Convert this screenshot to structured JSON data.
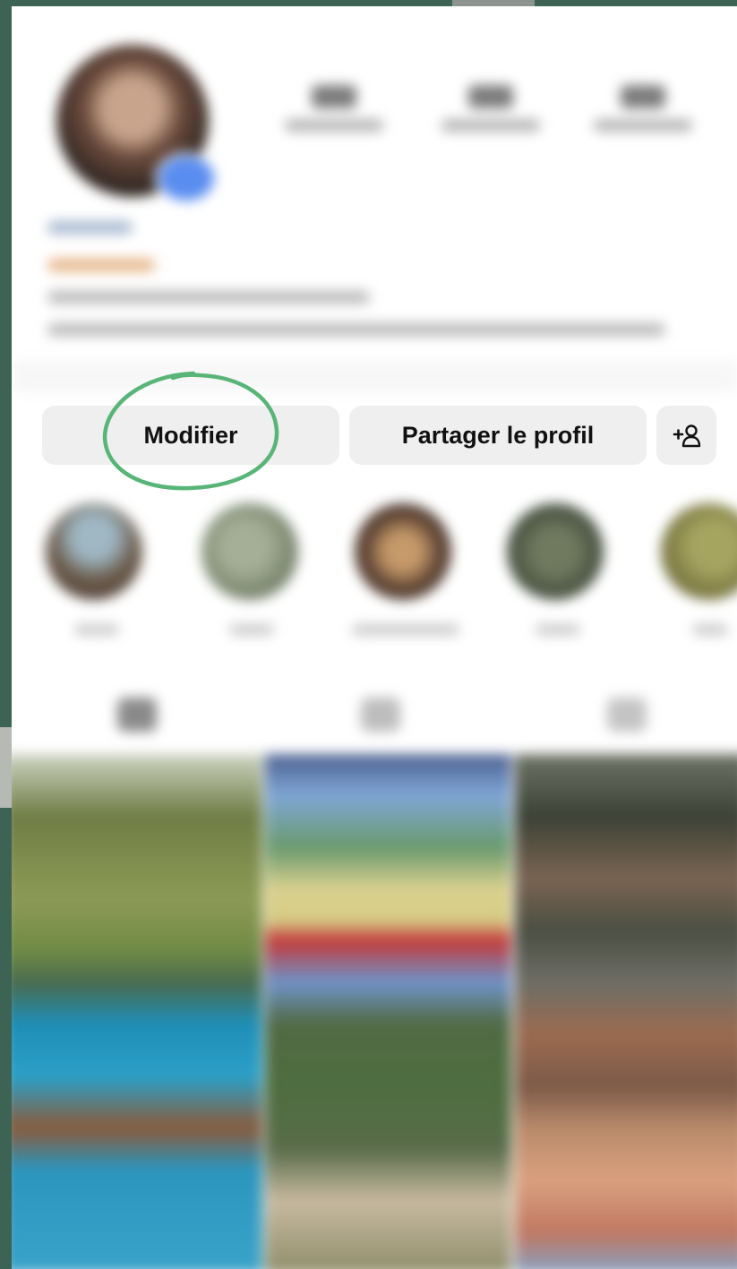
{
  "actions": {
    "edit_label": "Modifier",
    "share_label": "Partager le profil",
    "add_person_icon": "add-person-icon"
  },
  "annotation": {
    "type": "hand-drawn circle",
    "target": "edit-profile-button",
    "color": "#58b577"
  },
  "colors": {
    "frame_background": "#3c6354",
    "button_background": "#efefef",
    "button_text": "#111111"
  }
}
